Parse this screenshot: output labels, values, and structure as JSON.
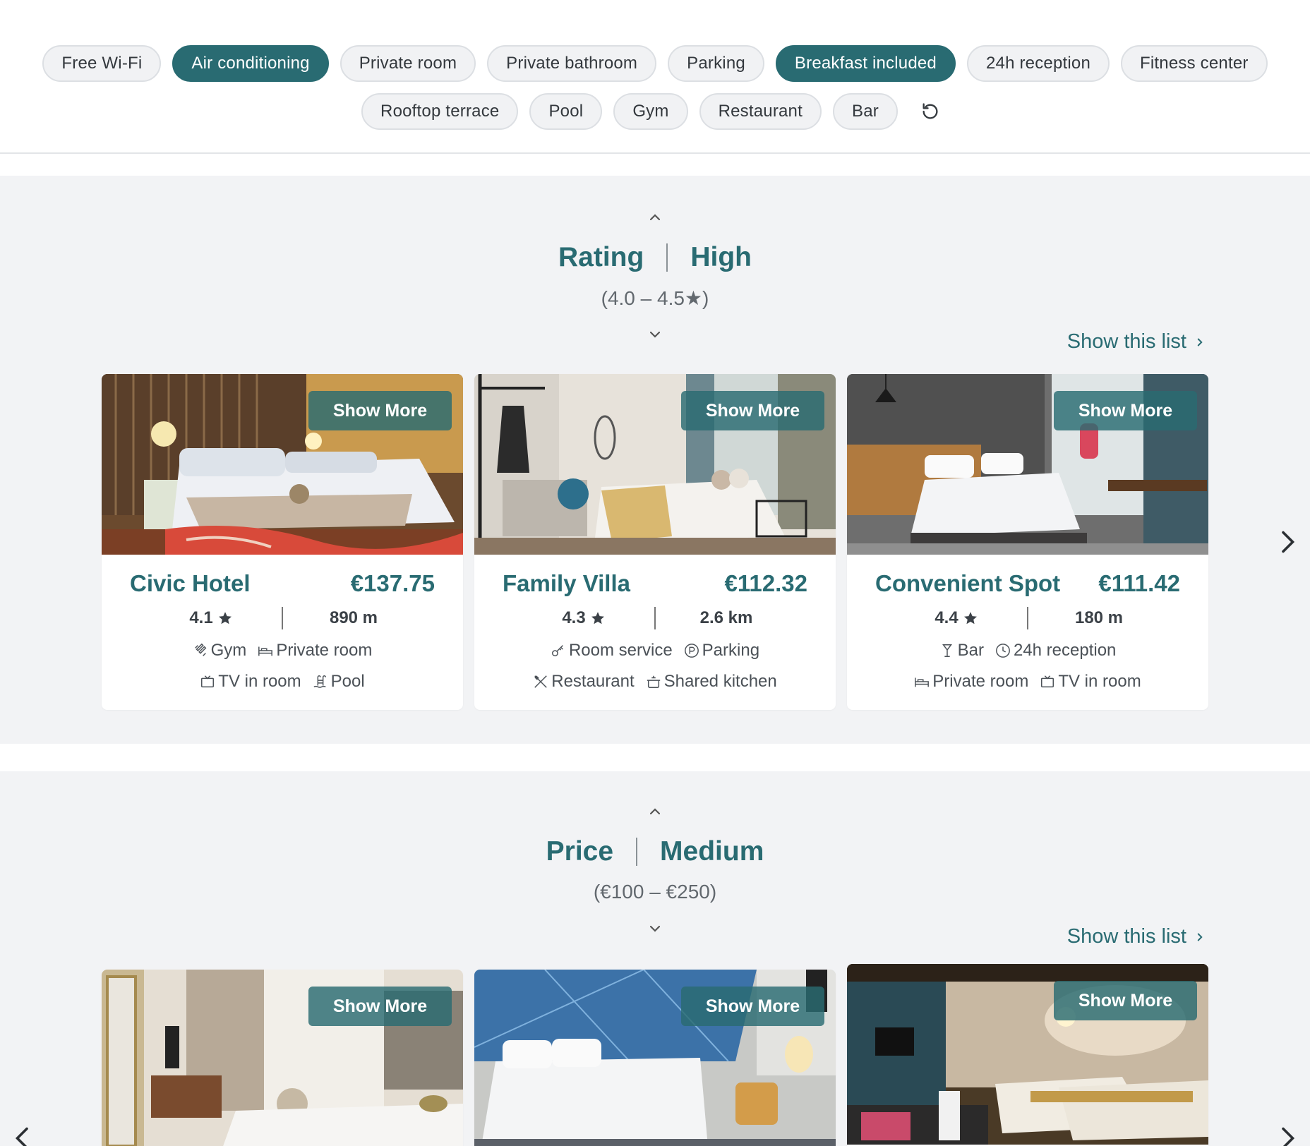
{
  "filters": {
    "row1": [
      {
        "label": "Free Wi-Fi",
        "active": false
      },
      {
        "label": "Air conditioning",
        "active": true
      },
      {
        "label": "Private room",
        "active": false
      },
      {
        "label": "Private bathroom",
        "active": false
      },
      {
        "label": "Parking",
        "active": false
      },
      {
        "label": "Breakfast included",
        "active": true
      },
      {
        "label": "24h reception",
        "active": false
      },
      {
        "label": "Fitness center",
        "active": false
      }
    ],
    "row2": [
      {
        "label": "Rooftop terrace",
        "active": false
      },
      {
        "label": "Pool",
        "active": false
      },
      {
        "label": "Gym",
        "active": false
      },
      {
        "label": "Restaurant",
        "active": false
      },
      {
        "label": "Bar",
        "active": false
      }
    ],
    "reset_icon": "reset-icon"
  },
  "colors": {
    "accent": "#296b72",
    "section_bg": "#f2f3f5",
    "chip_bg": "#f1f2f4"
  },
  "sections": [
    {
      "heading_left": "Rating",
      "heading_right": "High",
      "range": "(4.0 – 4.5★)",
      "show_list": "Show this list",
      "cards": [
        {
          "name": "Civic Hotel",
          "price": "€137.75",
          "rating": "4.1",
          "distance": "890 m",
          "show_more": "Show More",
          "amenities_row1": [
            {
              "icon": "gym-icon",
              "label": "Gym"
            },
            {
              "icon": "bed-icon",
              "label": "Private room"
            }
          ],
          "amenities_row2": [
            {
              "icon": "tv-icon",
              "label": "TV in room"
            },
            {
              "icon": "pool-icon",
              "label": "Pool"
            }
          ]
        },
        {
          "name": "Family Villa",
          "price": "€112.32",
          "rating": "4.3",
          "distance": "2.6 km",
          "show_more": "Show More",
          "amenities_row1": [
            {
              "icon": "key-icon",
              "label": "Room service"
            },
            {
              "icon": "parking-icon",
              "label": "Parking"
            }
          ],
          "amenities_row2": [
            {
              "icon": "utensils-icon",
              "label": "Restaurant"
            },
            {
              "icon": "pot-icon",
              "label": "Shared kitchen"
            }
          ]
        },
        {
          "name": "Convenient Spot",
          "price": "€111.42",
          "rating": "4.4",
          "distance": "180 m",
          "show_more": "Show More",
          "amenities_row1": [
            {
              "icon": "cocktail-icon",
              "label": "Bar"
            },
            {
              "icon": "clock-icon",
              "label": "24h reception"
            }
          ],
          "amenities_row2": [
            {
              "icon": "bed-icon",
              "label": "Private room"
            },
            {
              "icon": "tv-icon",
              "label": "TV in room"
            }
          ]
        }
      ]
    },
    {
      "heading_left": "Price",
      "heading_right": "Medium",
      "range": "(€100 – €250)",
      "show_list": "Show this list",
      "cards": [
        {
          "show_more": "Show More"
        },
        {
          "show_more": "Show More"
        },
        {
          "show_more": "Show More"
        }
      ]
    }
  ]
}
